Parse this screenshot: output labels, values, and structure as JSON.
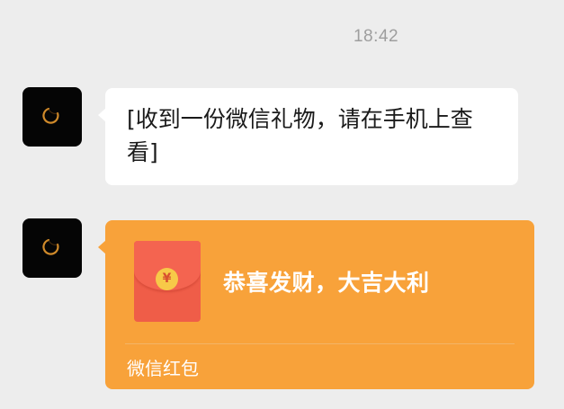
{
  "timestamp": "18:42",
  "messages": [
    {
      "type": "text",
      "avatar": "dark-crescent-avatar",
      "text": "[收到一份微信礼物，请在手机上查看]"
    },
    {
      "type": "red-packet",
      "avatar": "dark-crescent-avatar",
      "greeting": "恭喜发财，大吉大利",
      "coin_symbol": "¥",
      "footer": "微信红包",
      "icon": "red-envelope-icon"
    }
  ],
  "colors": {
    "background": "#ededed",
    "bubble": "#ffffff",
    "red_packet": "#f8a23a",
    "envelope": "#ef5d48",
    "coin": "#f7c948"
  }
}
